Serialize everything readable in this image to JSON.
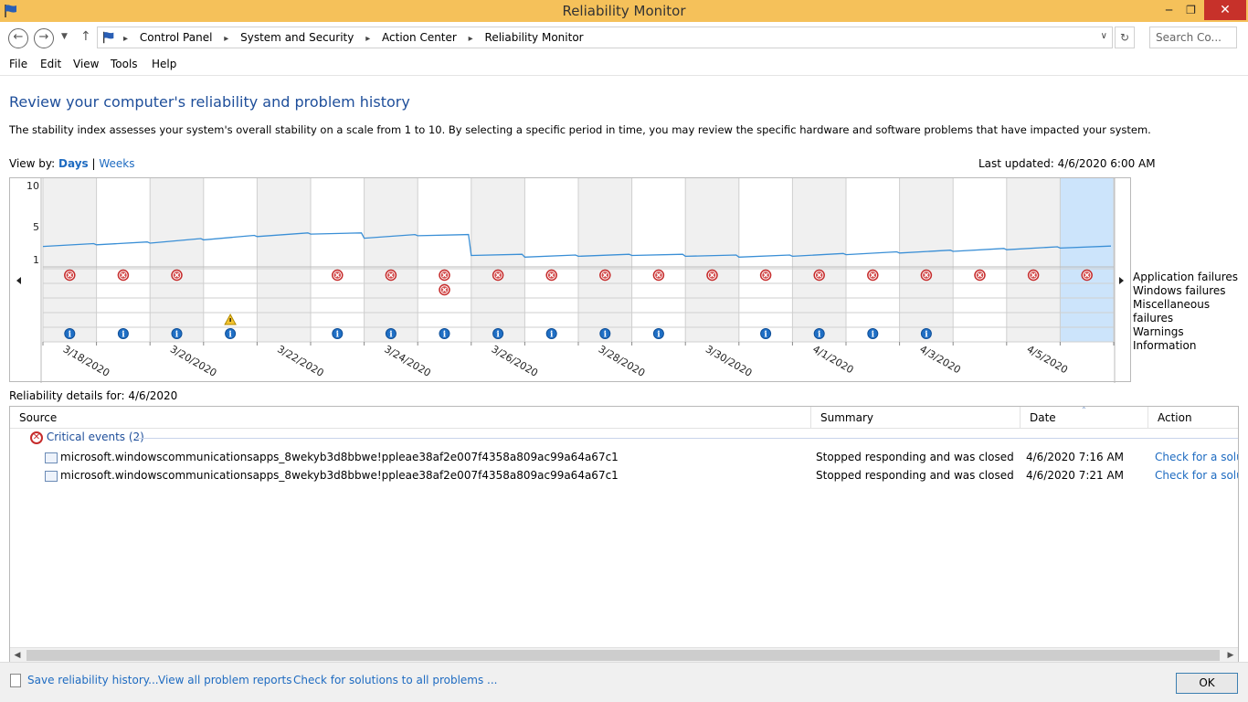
{
  "window": {
    "title": "Reliability Monitor",
    "min": "─",
    "max": "❐",
    "close": "✕"
  },
  "address": {
    "crumbs": [
      "Control Panel",
      "System and Security",
      "Action Center",
      "Reliability Monitor"
    ],
    "search_placeholder": "Search Co..."
  },
  "menu": [
    "File",
    "Edit",
    "View",
    "Tools",
    "Help"
  ],
  "page": {
    "heading": "Review your computer's reliability and problem history",
    "description": "The stability index assesses your system's overall stability on a scale from 1 to 10. By selecting a specific period in time, you may review the specific hardware and software problems that have impacted your system.",
    "view_by_label": "View by:",
    "view_days": "Days",
    "view_sep": "|",
    "view_weeks": "Weeks",
    "last_updated": "Last updated: 4/6/2020 6:00 AM"
  },
  "chart_data": {
    "type": "line",
    "ylim": [
      1,
      10
    ],
    "y_ticks": [
      "10",
      "5",
      "1"
    ],
    "columns": 20,
    "selected_column": 19,
    "x_labels": [
      {
        "col": 0,
        "label": "3/18/2020"
      },
      {
        "col": 2,
        "label": "3/20/2020"
      },
      {
        "col": 4,
        "label": "3/22/2020"
      },
      {
        "col": 6,
        "label": "3/24/2020"
      },
      {
        "col": 8,
        "label": "3/26/2020"
      },
      {
        "col": 10,
        "label": "3/28/2020"
      },
      {
        "col": 12,
        "label": "3/30/2020"
      },
      {
        "col": 14,
        "label": "4/1/2020"
      },
      {
        "col": 16,
        "label": "4/3/2020"
      },
      {
        "col": 18,
        "label": "4/5/2020"
      }
    ],
    "stability_index": [
      2.6,
      2.8,
      3.0,
      3.4,
      3.8,
      4.1,
      3.6,
      3.9,
      1.5,
      1.3,
      1.4,
      1.5,
      1.4,
      1.3,
      1.4,
      1.6,
      1.8,
      2.0,
      2.2,
      2.4
    ],
    "rows": [
      "Application failures",
      "Windows failures",
      "Miscellaneous failures",
      "Warnings",
      "Information"
    ],
    "app_failures": [
      0,
      1,
      2,
      5,
      6,
      7,
      8,
      9,
      10,
      11,
      12,
      13,
      14,
      15,
      16,
      17,
      18,
      19
    ],
    "windows_failures": [
      7
    ],
    "warnings": [
      3
    ],
    "information": [
      0,
      1,
      2,
      3,
      5,
      6,
      7,
      8,
      9,
      10,
      11,
      13,
      14,
      15,
      16
    ],
    "colors": {
      "line": "#3a8fd6",
      "selected": "#cce4fb",
      "shaded": "#f0f0f0"
    }
  },
  "details": {
    "title": "Reliability details for: 4/6/2020",
    "columns": [
      "Source",
      "Summary",
      "Date",
      "Action"
    ],
    "group": "Critical events (2)",
    "rows": [
      {
        "source": "microsoft.windowscommunicationsapps_8wekyb3d8bbwe!ppleae38af2e007f4358a809ac99a64a67c1",
        "summary": "Stopped responding and was closed",
        "date": "4/6/2020 7:16 AM",
        "action": "Check for a solution"
      },
      {
        "source": "microsoft.windowscommunicationsapps_8wekyb3d8bbwe!ppleae38af2e007f4358a809ac99a64a67c1",
        "summary": "Stopped responding and was closed",
        "date": "4/6/2020 7:21 AM",
        "action": "Check for a solution"
      }
    ]
  },
  "footer": {
    "save": "Save reliability history...",
    "view_all": "View all problem reports",
    "check_all": "Check for solutions to all problems ...",
    "ok": "OK"
  }
}
